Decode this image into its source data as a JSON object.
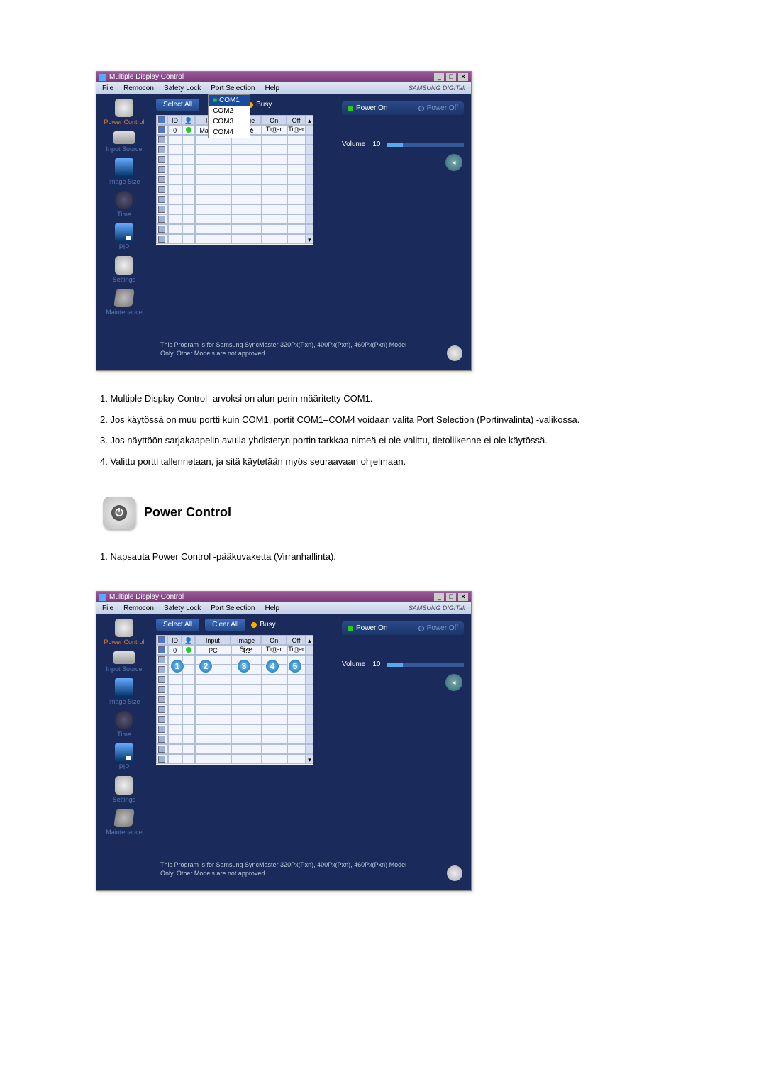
{
  "app": {
    "title": "Multiple Display Control",
    "brand": "SAMSUNG DIGITall",
    "menu": [
      "File",
      "Remocon",
      "Safety Lock",
      "Port Selection",
      "Help"
    ],
    "port_options": [
      "COM1",
      "COM2",
      "COM3",
      "COM4"
    ],
    "port_selected": "COM1",
    "sidebar": [
      {
        "label": "Power Control",
        "active": true,
        "icon": "power"
      },
      {
        "label": "Input Source",
        "active": false,
        "icon": "input"
      },
      {
        "label": "Image Size",
        "active": false,
        "icon": "image"
      },
      {
        "label": "Time",
        "active": false,
        "icon": "time"
      },
      {
        "label": "PIP",
        "active": false,
        "icon": "pip"
      },
      {
        "label": "Settings",
        "active": false,
        "icon": "settings"
      },
      {
        "label": "Maintenance",
        "active": false,
        "icon": "maint"
      }
    ],
    "buttons": {
      "select_all": "Select All",
      "clear_all": "Clear All"
    },
    "busy_label": "Busy",
    "grid": {
      "columns": [
        "",
        "ID",
        "",
        "Input",
        "Image Size",
        "On Timer",
        "Off Timer"
      ],
      "rows": [
        {
          "checked": true,
          "id": "0",
          "status": "green",
          "input": "MagicNet",
          "image": "Wide",
          "on": "o",
          "off": "o"
        }
      ],
      "rows2": [
        {
          "checked": true,
          "id": "0",
          "status": "green",
          "input": "PC",
          "image": "4:3",
          "on": "o",
          "off": "o"
        }
      ],
      "empty_rows": 11
    },
    "power": {
      "on_label": "Power On",
      "off_label": "Power Off",
      "volume_label": "Volume",
      "volume_value": "10"
    },
    "footer": "This Program is for Samsung SyncMaster 320Px(Pxn), 400Px(Pxn), 460Px(Pxn)  Model Only. Other Models are not approved."
  },
  "text": {
    "para1": "1. Multiple Display Control -arvoksi on alun perin määritetty COM1.",
    "para2": "2. Jos käytössä on muu portti kuin COM1, portit COM1–COM4 voidaan valita Port Selection (Portinvalinta) -valikossa.",
    "para3": "3. Jos näyttöön sarjakaapelin avulla yhdistetyn portin tarkkaa nimeä ei ole valittu, tietoliikenne ei ole käytössä.",
    "para4": "4. Valittu portti tallennetaan, ja sitä käytetään myös seuraavaan ohjelmaan.",
    "section_title": "Power Control",
    "para5": "1. Napsauta Power Control -pääkuvaketta (Virranhallinta)."
  },
  "callouts": [
    "1",
    "2",
    "3",
    "4",
    "5"
  ]
}
